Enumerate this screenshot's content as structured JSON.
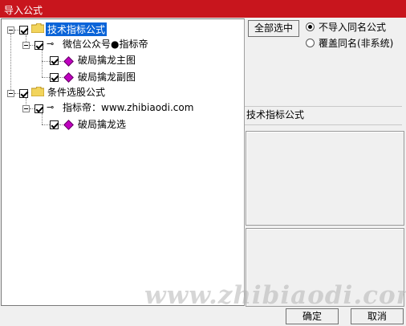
{
  "window": {
    "title": "导入公式"
  },
  "tree": {
    "root1": {
      "label": "技术指标公式"
    },
    "group1": {
      "label": "微信公众号●指标帝"
    },
    "item1": {
      "label": "破局擒龙主图"
    },
    "item2": {
      "label": "破局擒龙副图"
    },
    "root2": {
      "label": "条件选股公式"
    },
    "group2": {
      "label": "指标帝：www.zhibiaodi.com"
    },
    "item3": {
      "label": "破局擒龙选"
    }
  },
  "controls": {
    "select_all_label": "全部选中",
    "radio_skip_label": "不导入同名公式",
    "radio_overwrite_label": "覆盖同名(非系统)",
    "radio_selected": "不导入同名公式"
  },
  "info": {
    "label": "技术指标公式"
  },
  "buttons": {
    "ok": "确定",
    "cancel": "取消"
  },
  "watermark": {
    "text": "www.zhibiaodi.com"
  },
  "colors": {
    "titlebar": "#c8151d",
    "selection": "#0a64d8",
    "item_icon": "#c000c0"
  }
}
